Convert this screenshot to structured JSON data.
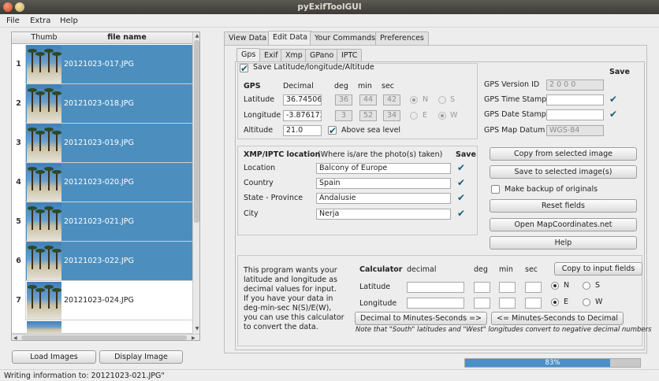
{
  "window": {
    "title": "pyExifToolGUI"
  },
  "menu": [
    "File",
    "Extra",
    "Help"
  ],
  "list": {
    "headers": {
      "thumb": "Thumb",
      "file": "file name"
    },
    "rows": [
      {
        "n": "1",
        "file": "20121023-017.JPG"
      },
      {
        "n": "2",
        "file": "20121023-018.JPG"
      },
      {
        "n": "3",
        "file": "20121023-019.JPG"
      },
      {
        "n": "4",
        "file": "20121023-020.JPG"
      },
      {
        "n": "5",
        "file": "20121023-021.JPG"
      },
      {
        "n": "6",
        "file": "20121023-022.JPG"
      },
      {
        "n": "7",
        "file": "20121023-024.JPG"
      }
    ]
  },
  "buttons": {
    "load": "Load Images",
    "display": "Display Image"
  },
  "tabs": [
    "View Data",
    "Edit Data",
    "Your Commands",
    "Preferences"
  ],
  "subtabs": [
    "Gps",
    "Exif",
    "Xmp",
    "GPano",
    "IPTC"
  ],
  "gps": {
    "save_lat_label": "Save Latitude/longitude/Altitude",
    "headers": {
      "gps": "GPS",
      "decimal": "Decimal",
      "deg": "deg",
      "min": "min",
      "sec": "sec"
    },
    "lat_label": "Latitude",
    "lat": "36.745069",
    "lat_deg": "36",
    "lat_min": "44",
    "lat_sec": "42",
    "N": "N",
    "S": "S",
    "lon_label": "Longitude",
    "lon": "-3.876172",
    "lon_deg": "3",
    "lon_min": "52",
    "lon_sec": "34",
    "E": "E",
    "W": "W",
    "alt_label": "Altitude",
    "alt": "21.0",
    "above_sea": "Above sea level",
    "save": "Save",
    "version_label": "GPS Version ID",
    "version": "2 0 0 0",
    "time_label": "GPS Time Stamp",
    "date_label": "GPS Date Stamp",
    "datum_label": "GPS Map Datum",
    "datum": "WGS-84"
  },
  "xmp": {
    "title": "XMP/IPTC location",
    "hint": "(Where is/are the photo(s) taken)",
    "save": "Save",
    "location_label": "Location",
    "location": "Balcony of Europe",
    "country_label": "Country",
    "country": "Spain",
    "state_label": "State - Province",
    "state": "Andalusie",
    "city_label": "City",
    "city": "Nerja"
  },
  "actions": {
    "copy": "Copy from selected image",
    "save": "Save to selected image(s)",
    "backup": "Make backup of originals",
    "reset": "Reset fields",
    "open": "Open MapCoordinates.net",
    "help": "Help"
  },
  "calc": {
    "desc": [
      "This program wants your",
      "latitude and longitude as",
      "decimal values for input.",
      "If you have your data in",
      "deg-min-sec N(S)/E(W),",
      "you can use this calculator",
      "to convert the data."
    ],
    "title": "Calculator",
    "decimal": "decimal",
    "deg": "deg",
    "min": "min",
    "sec": "sec",
    "copy": "Copy to input fields",
    "lat": "Latitude",
    "lon": "Longitude",
    "N": "N",
    "S": "S",
    "E": "E",
    "W": "W",
    "to_dms": "Decimal to Minutes-Seconds =>",
    "to_dec": "<= Minutes-Seconds to Decimal",
    "note": "Note that \"South\" latitudes and \"West\" longitudes convert to negative decimal numbers"
  },
  "progress": {
    "value": 0.83,
    "label": "83%"
  },
  "status": "Writing information to: 20121023-021.JPG\"",
  "colors": {
    "selection": "#4c8fbf",
    "progress": "#4a90c9"
  }
}
